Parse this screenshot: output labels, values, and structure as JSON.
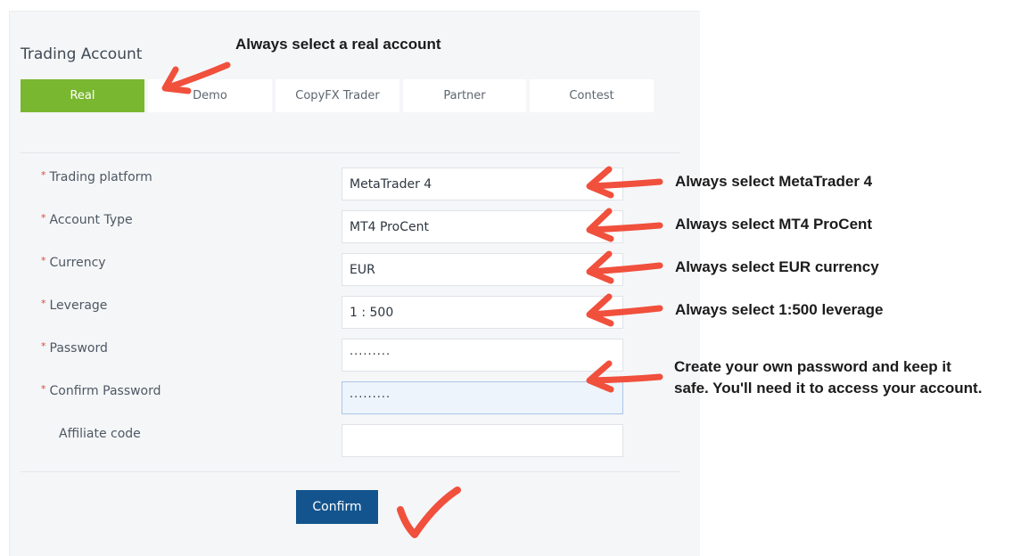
{
  "panel": {
    "title": "Trading Account",
    "tabs": [
      {
        "label": "Real",
        "active": true
      },
      {
        "label": "Demo",
        "active": false
      },
      {
        "label": "CopyFX Trader",
        "active": false
      },
      {
        "label": "Partner",
        "active": false
      },
      {
        "label": "Contest",
        "active": false
      }
    ]
  },
  "form": {
    "fields": [
      {
        "label": "Trading platform",
        "value": "MetaTrader 4",
        "required": true
      },
      {
        "label": "Account Type",
        "value": "MT4 ProCent",
        "required": true
      },
      {
        "label": "Currency",
        "value": "EUR",
        "required": true
      },
      {
        "label": "Leverage",
        "value": "1 : 500",
        "required": true
      },
      {
        "label": "Password",
        "value": "·········",
        "required": true
      },
      {
        "label": "Confirm Password",
        "value": "·········",
        "required": true
      },
      {
        "label": "Affiliate code",
        "value": "",
        "required": false
      }
    ],
    "required_marker": "*",
    "confirm_label": "Confirm"
  },
  "annotations": {
    "real_account": "Always select a real account",
    "platform": "Always select MetaTrader 4",
    "account_type": "Always select MT4 ProCent",
    "currency": "Always select EUR currency",
    "leverage": "Always select 1:500 leverage",
    "password_line1": "Create your own password and keep it",
    "password_line2": "safe. You'll need it to access your account."
  },
  "colors": {
    "active_tab": "#7ab730",
    "confirm_button": "#13548e",
    "annotation_arrow": "#f0503c",
    "required_marker": "#e0453a"
  },
  "icons": {
    "arrow": "hand-drawn-arrow-icon",
    "check": "hand-drawn-checkmark-icon"
  }
}
